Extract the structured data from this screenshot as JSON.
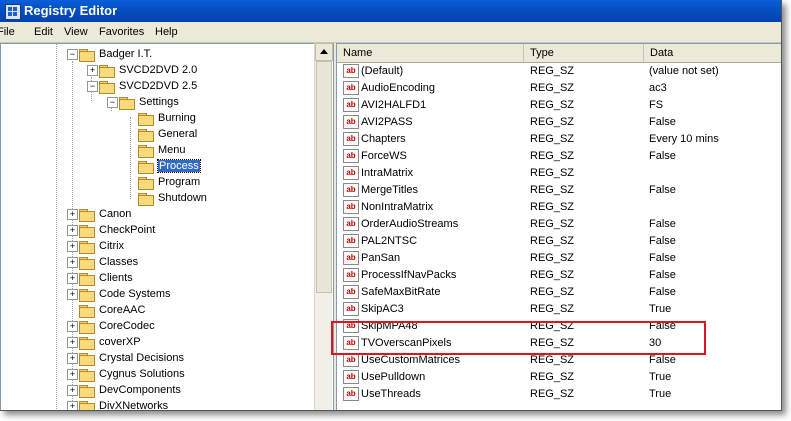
{
  "window": {
    "title": "Registry Editor"
  },
  "menu": [
    "File",
    "Edit",
    "View",
    "Favorites",
    "Help"
  ],
  "tree": {
    "items": [
      {
        "label": "Badger I.T.",
        "expander": "−",
        "selected": false
      },
      {
        "label": "SVCD2DVD 2.0",
        "expander": "+",
        "selected": false
      },
      {
        "label": "SVCD2DVD 2.5",
        "expander": "−",
        "selected": false
      },
      {
        "label": "Settings",
        "expander": "−",
        "selected": false
      },
      {
        "label": "Burning",
        "expander": "",
        "selected": false
      },
      {
        "label": "General",
        "expander": "",
        "selected": false
      },
      {
        "label": "Menu",
        "expander": "",
        "selected": false
      },
      {
        "label": "Process",
        "expander": "",
        "selected": true
      },
      {
        "label": "Program",
        "expander": "",
        "selected": false
      },
      {
        "label": "Shutdown",
        "expander": "",
        "selected": false
      },
      {
        "label": "Canon",
        "expander": "+",
        "selected": false
      },
      {
        "label": "CheckPoint",
        "expander": "+",
        "selected": false
      },
      {
        "label": "Citrix",
        "expander": "+",
        "selected": false
      },
      {
        "label": "Classes",
        "expander": "+",
        "selected": false
      },
      {
        "label": "Clients",
        "expander": "+",
        "selected": false
      },
      {
        "label": "Code Systems",
        "expander": "+",
        "selected": false
      },
      {
        "label": "CoreAAC",
        "expander": "",
        "selected": false
      },
      {
        "label": "CoreCodec",
        "expander": "+",
        "selected": false
      },
      {
        "label": "coverXP",
        "expander": "+",
        "selected": false
      },
      {
        "label": "Crystal Decisions",
        "expander": "+",
        "selected": false
      },
      {
        "label": "Cygnus Solutions",
        "expander": "+",
        "selected": false
      },
      {
        "label": "DevComponents",
        "expander": "+",
        "selected": false
      },
      {
        "label": "DivXNetworks",
        "expander": "+",
        "selected": false
      }
    ]
  },
  "list": {
    "headers": {
      "name": "Name",
      "type": "Type",
      "data": "Data"
    },
    "icon_text": "ab",
    "rows": [
      {
        "name": "(Default)",
        "type": "REG_SZ",
        "data": "(value not set)"
      },
      {
        "name": "AudioEncoding",
        "type": "REG_SZ",
        "data": "ac3"
      },
      {
        "name": "AVI2HALFD1",
        "type": "REG_SZ",
        "data": "FS"
      },
      {
        "name": "AVI2PASS",
        "type": "REG_SZ",
        "data": "False"
      },
      {
        "name": "Chapters",
        "type": "REG_SZ",
        "data": "Every 10 mins"
      },
      {
        "name": "ForceWS",
        "type": "REG_SZ",
        "data": "False"
      },
      {
        "name": "IntraMatrix",
        "type": "REG_SZ",
        "data": ""
      },
      {
        "name": "MergeTitles",
        "type": "REG_SZ",
        "data": "False"
      },
      {
        "name": "NonIntraMatrix",
        "type": "REG_SZ",
        "data": ""
      },
      {
        "name": "OrderAudioStreams",
        "type": "REG_SZ",
        "data": "False"
      },
      {
        "name": "PAL2NTSC",
        "type": "REG_SZ",
        "data": "False"
      },
      {
        "name": "PanSan",
        "type": "REG_SZ",
        "data": "False"
      },
      {
        "name": "ProcessIfNavPacks",
        "type": "REG_SZ",
        "data": "False"
      },
      {
        "name": "SafeMaxBitRate",
        "type": "REG_SZ",
        "data": "False"
      },
      {
        "name": "SkipAC3",
        "type": "REG_SZ",
        "data": "True"
      },
      {
        "name": "SkipMPA48",
        "type": "REG_SZ",
        "data": "False"
      },
      {
        "name": "TVOverscanPixels",
        "type": "REG_SZ",
        "data": "30"
      },
      {
        "name": "UseCustomMatrices",
        "type": "REG_SZ",
        "data": "False"
      },
      {
        "name": "UsePulldown",
        "type": "REG_SZ",
        "data": "True"
      },
      {
        "name": "UseThreads",
        "type": "REG_SZ",
        "data": "True"
      }
    ]
  },
  "highlight": {
    "color": "#e0141e",
    "row_name": "TVOverscanPixels"
  }
}
